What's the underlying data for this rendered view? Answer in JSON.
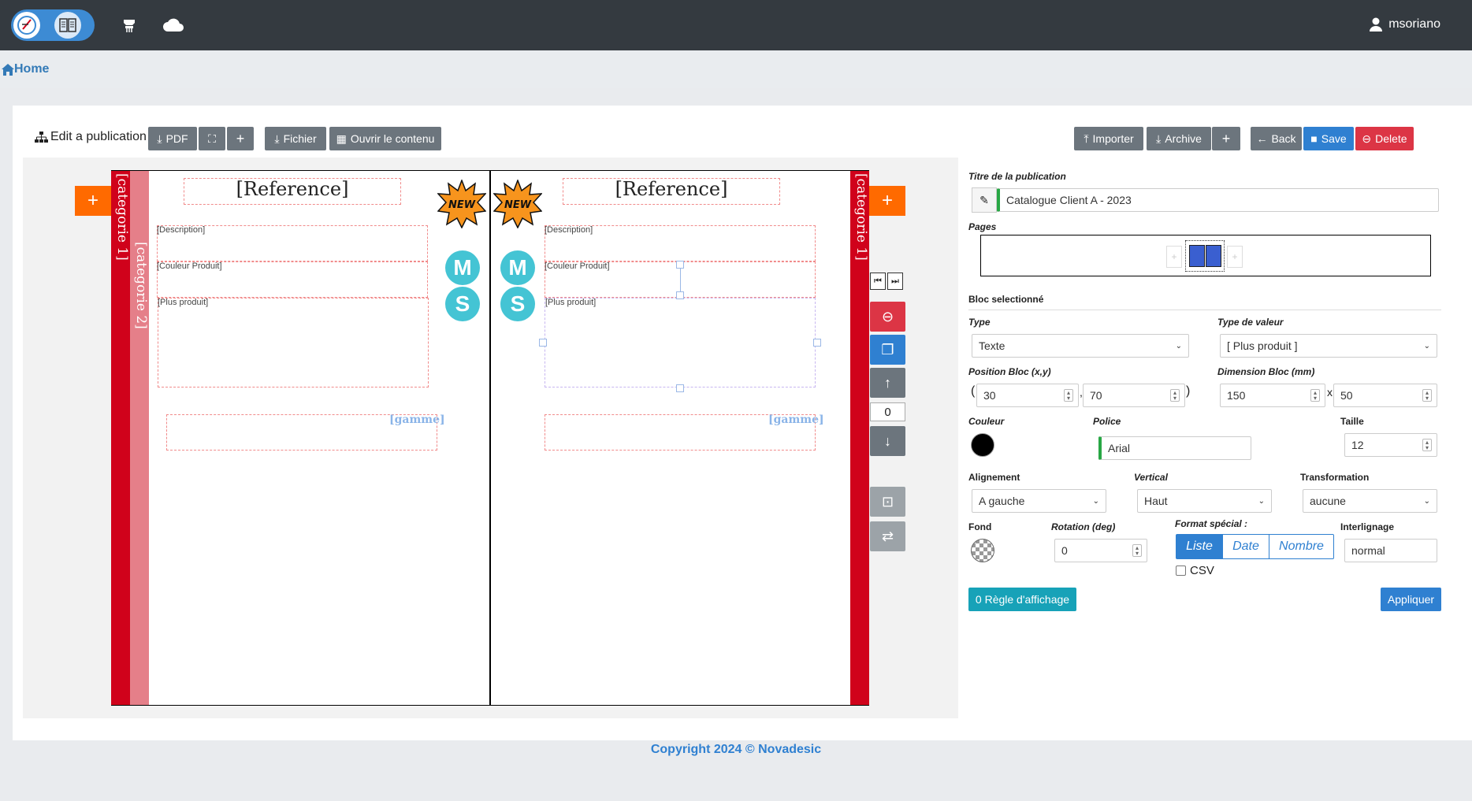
{
  "user": {
    "name": "msoriano"
  },
  "breadcrumb": {
    "home": "Home"
  },
  "toolbar": {
    "title": "Edit a publication",
    "pdf": "PDF",
    "fichier": "Fichier",
    "ouvrir": "Ouvrir le contenu",
    "importer": "Importer",
    "archive": "Archive",
    "back": "Back",
    "save": "Save",
    "delete": "Delete"
  },
  "canvas": {
    "left_page": {
      "category1": "[categorie 1]",
      "category2": "[categorie 2]",
      "reference": "[Reference]",
      "description": "[Description]",
      "couleur": "[Couleur Produit]",
      "plus": "[Plus produit]",
      "gamme": "[gamme]",
      "badge": "NEW",
      "circle_m": "M",
      "circle_s": "S"
    },
    "right_page": {
      "category1": "[categorie 1]",
      "reference": "[Reference]",
      "description": "[Description]",
      "couleur": "[Couleur Produit]",
      "plus": "[Plus produit]",
      "gamme": "[gamme]",
      "badge": "NEW",
      "circle_m": "M",
      "circle_s": "S"
    },
    "layer_index": "0"
  },
  "form": {
    "titre_label": "Titre de la publication",
    "titre_value": "Catalogue Client A - 2023",
    "pages_label": "Pages",
    "bloc_label": "Bloc selectionné",
    "type_label": "Type",
    "type_value": "Texte",
    "valeur_label": "Type de valeur",
    "valeur_value": "[ Plus produit ]",
    "position_label": "Position Bloc (x,y)",
    "pos_x": "30",
    "pos_y": "70",
    "dimension_label": "Dimension Bloc (mm)",
    "dim_w": "150",
    "dim_h": "50",
    "couleur_label": "Couleur",
    "police_label": "Police",
    "police_value": "Arial",
    "taille_label": "Taille",
    "taille_value": "12",
    "alignement_label": "Alignement",
    "alignement_value": "A gauche",
    "vertical_label": "Vertical",
    "vertical_value": "Haut",
    "transformation_label": "Transformation",
    "transformation_value": "aucune",
    "fond_label": "Fond",
    "rotation_label": "Rotation (deg)",
    "rotation_value": "0",
    "format_label": "Format spécial :",
    "format_liste": "Liste",
    "format_date": "Date",
    "format_nombre": "Nombre",
    "csv_label": "CSV",
    "interlignage_label": "Interlignage",
    "interlignage_value": "normal",
    "regle_button": "0 Règle d'affichage",
    "appliquer_button": "Appliquer"
  },
  "footer": {
    "copyright": "Copyright 2024 © Novadesic"
  },
  "colors": {
    "nav": "#343a40",
    "accent": "#2f80d1",
    "danger": "#dc3545",
    "category_red": "#d0021b",
    "orange": "#ff6a00",
    "teal": "#17a2b8"
  }
}
